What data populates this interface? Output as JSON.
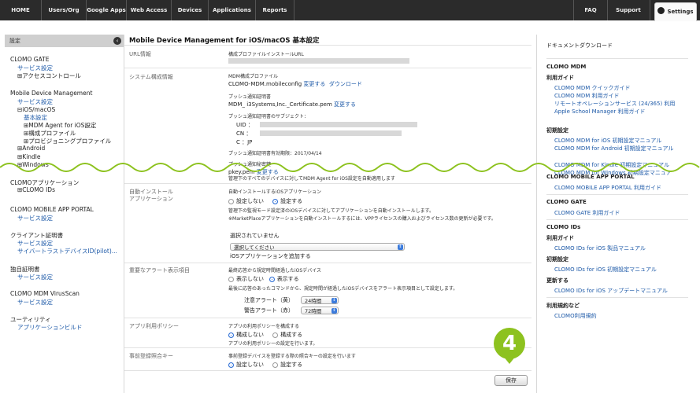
{
  "nav": {
    "left_tabs": [
      "HOME",
      "Users/Org",
      "Google Apps",
      "Web Access",
      "Devices",
      "Applications",
      "Reports"
    ],
    "right_tabs": [
      "FAQ",
      "Support"
    ],
    "settings": "Settings"
  },
  "sidebar": {
    "header": "設定",
    "clomo_gate": "CLOMO GATE",
    "service_setting_1": "サービス設定",
    "access_control": "⊞アクセスコントロール",
    "mdm": "Mobile Device Management",
    "service_setting_2": "サービス設定",
    "ios_macos": "⊟iOS/macOS",
    "basic_setting": "基本設定",
    "mdm_agent": "⊞MDM Agent for iOS設定",
    "profile": "⊞構成プロファイル",
    "provisioning": "⊞プロビジョニングプロファイル",
    "android": "⊞Android",
    "kindle": "⊞Kindle",
    "windows": "⊞Windows",
    "clomo_app": "CLOMOアプリケーション",
    "clomo_ids": "⊞CLOMO IDs",
    "portal": "CLOMO MOBILE APP PORTAL",
    "service_setting_3": "サービス設定",
    "client_cert": "クライアント証明書",
    "service_setting_4": "サービス設定",
    "cybertrust": "サイバートラストデバイスID(pilot)...",
    "own_cert": "独自証明書",
    "service_setting_5": "サービス設定",
    "virusscan": "CLOMO MDM VirusScan",
    "service_setting_6": "サービス設定",
    "utility": "ユーティリティ",
    "app_build": "アプリケーションビルド"
  },
  "main": {
    "title": "Mobile Device Management for iOS/macOS 基本設定",
    "url_label": "URL情報",
    "url_sub": "構成プロファイルインストールURL",
    "sys_label": "システム構成情報",
    "mdm_profile_sub": "MDM構成プロファイル",
    "mdm_profile_name": "CLOMO-MDM.mobileconfig",
    "change": "変更する",
    "download": "ダウンロード",
    "push_cert_sub": "プッシュ通知証明書",
    "push_cert_name": "MDM_ i3Systems,Inc._Certificate.pem",
    "push_subject_sub": "プッシュ通知証明書のサブジェクト：",
    "uid": "UID ：",
    "cn": "CN ：",
    "c": "C  ：JP",
    "expire": "プッシュ通知証明書有効期限：2017/04/14",
    "push_key_sub": "プッシュ通知秘密鍵",
    "push_key_name": "pkey.pem",
    "change2": "変更する",
    "agent_note": "管理下のすべてのデバイスに対してMDM Agent for iOS設定を自動適用します",
    "auto_label": "自動インストール",
    "auto_label2": "アプリケーション",
    "auto_sub": "自動インストールするiOSアプリケーション",
    "no_setting": "設定しない",
    "do_setting": "設定する",
    "auto_desc1": "管理下の監視モード設定済のiOSデバイスに対してアプリケーションを自動インストールします。",
    "auto_desc2": "※MarketPlaceアプリケーションを自動インストールするには、VPPライセンスの購入およびライセンス数の更新が必要です。",
    "not_selected": "選択されていません",
    "please_select": "選択してください",
    "add_ios_app": "iOSアプリケーションを追加する",
    "alert_label": "重要なアラート表示項目",
    "alert_sub": "最終応答から規定時間経過したiOSデバイス",
    "hide": "表示しない",
    "show": "表示する",
    "alert_desc": "最後に応答のあったコマンドから、規定時間が経過したiOSデバイスをアラート表示項目として設定します。",
    "caution": "注意アラート（黄）",
    "caution_val": "24時間",
    "warning": "警告アラート（赤）",
    "warning_val": "72時間",
    "policy_label": "アプリ利用ポリシー",
    "policy_sub": "アプリの利用ポリシーを構成する",
    "configure_no": "構成しない",
    "configure_yes": "構成する",
    "policy_desc": "アプリの利用ポリシーの設定を行います。",
    "prereg_label": "事前登録照合キー",
    "prereg_sub": "事前登録デバイスを登録する際の照合キーの設定を行います",
    "prereg_no": "設定しない",
    "prereg_yes": "設定する",
    "save": "保存"
  },
  "right": {
    "header": "ドキュメントダウンロード",
    "clomo_mdm": "CLOMO MDM",
    "guide": "利用ガイド",
    "quick": "CLOMO MDM クイックガイド",
    "usage": "CLOMO MDM 利用ガイド",
    "remote": "リモートオペレーションサービス (24/365) 利用",
    "asm": "Apple School Manager 利用ガイド",
    "initial": "初期設定",
    "init_ios": "CLOMO MDM for iOS 初期設定マニュアル",
    "init_android": "CLOMO MDM for Android 初期設定マニュアル",
    "init_kindle": "CLOMO MDM for Kindle 初期設定マニュアル",
    "init_windows": "CLOMO MDM for Windows 初期設定マニュア",
    "portal_h": "CLOMO MOBILE APP PORTAL",
    "portal_guide": "CLOMO MOBILE APP PORTAL 利用ガイド",
    "gate_h": "CLOMO GATE",
    "gate_guide": "CLOMO GATE 利用ガイド",
    "ids_h": "CLOMO IDs",
    "ids_usage": "利用ガイド",
    "ids_product": "CLOMO IDs for iOS 製品マニュアル",
    "ids_initial": "初期設定",
    "ids_init_manual": "CLOMO IDs for iOS 初期設定マニュアル",
    "update": "更新する",
    "ids_update": "CLOMO IDs for iOS アップデートマニュアル",
    "terms_h": "利用規約など",
    "terms": "CLOMO利用規約"
  },
  "badge": "4",
  "colors": {
    "accent": "#8dc21f",
    "link": "#1e5aa8",
    "topbar": "#2b2b2b"
  }
}
